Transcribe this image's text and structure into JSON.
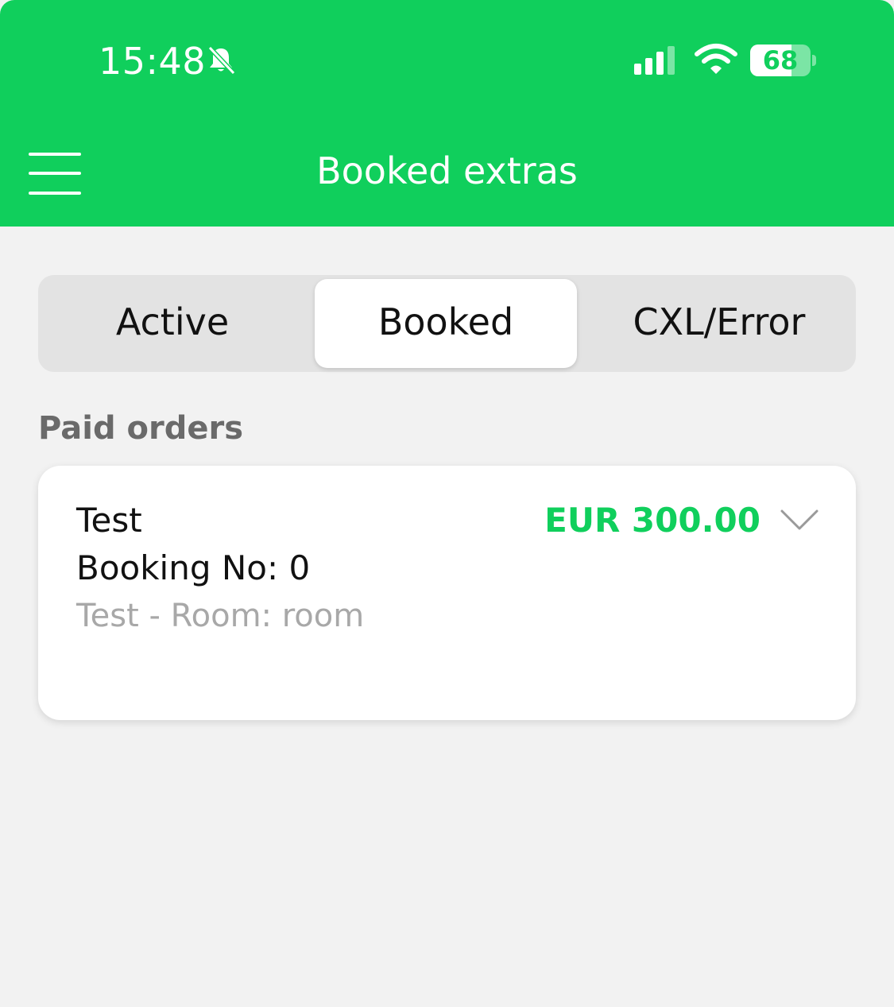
{
  "status_bar": {
    "time": "15:48",
    "battery_level": "68",
    "icons": [
      "bell-slash-icon",
      "cellular-signal-icon",
      "wifi-icon",
      "battery-icon"
    ]
  },
  "header": {
    "title": "Booked extras",
    "menu_icon": "hamburger-menu-icon",
    "background_color": "#10cf5c"
  },
  "tabs": [
    {
      "label": "Active",
      "selected": false
    },
    {
      "label": "Booked",
      "selected": true
    },
    {
      "label": "CXL/Error",
      "selected": false
    }
  ],
  "section": {
    "title": "Paid orders"
  },
  "orders": [
    {
      "title": "Test",
      "booking": "Booking No: 0",
      "subtitle": "Test - Room: room",
      "price": "EUR 300.00",
      "expand_icon": "chevron-down-icon"
    }
  ],
  "colors": {
    "accent": "#10cf5c",
    "page_background": "#f2f2f2",
    "muted_text": "#a8a8a8"
  }
}
